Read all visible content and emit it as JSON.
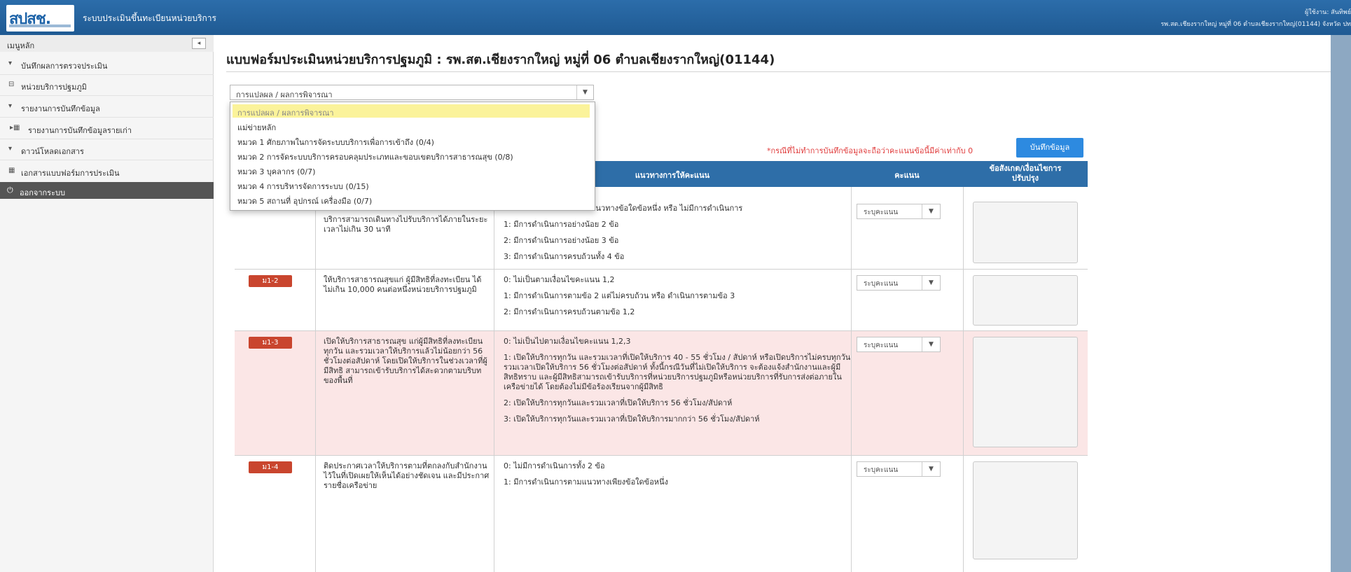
{
  "header": {
    "logo_text": "สปสช.",
    "app_title": "ระบบประเมินขึ้นทะเบียนหน่วยบริการ",
    "user_line1": "ผู้ใช้งาน: สันทิพย์",
    "user_line2": "รพ.สต.เชียงรากใหญ่ หมู่ที่ 06 ตำบลเชียงรากใหญ่(01144)   จังหวัด ปท"
  },
  "sidebar": {
    "main_menu": "เมนูหลัก",
    "collapse_icon": "◂",
    "sections": [
      {
        "label": "บันทึกผลการตรวจประเมิน"
      },
      {
        "label": "หน่วยบริการปฐมภูมิ"
      },
      {
        "label": "รายงานการบันทึกข้อมูล"
      },
      {
        "label": "รายงานการบันทึกข้อมูลรายเก่า"
      },
      {
        "label": "ดาวน์โหลดเอกสาร"
      },
      {
        "label": "เอกสารแบบฟอร์มการประเมิน"
      }
    ],
    "logout": "ออกจากระบบ"
  },
  "main": {
    "page_title": "แบบฟอร์มประเมินหน่วยบริการปฐมภูมิ : รพ.สต.เชียงรากใหญ่ หมู่ที่ 06 ตำบลเชียงรากใหญ่(01144)",
    "category_select": {
      "value": "การแปลผล / ผลการพิจารณา",
      "options": [
        "การแปลผล / ผลการพิจารณา",
        "แม่ข่ายหลัก",
        "หมวด 1 ศักยภาพในการจัดระบบบริการเพื่อการเข้าถึง (0/4)",
        "หมวด 2 การจัดระบบบริการครอบคลุมประเภทและขอบเขตบริการสาธารณสุข (0/8)",
        "หมวด 3 บุคลากร (0/7)",
        "หมวด 4 การบริหารจัดการระบบ (0/15)",
        "หมวด 5 สถานที่ อุปกรณ์ เครื่องมือ (0/7)"
      ]
    },
    "note": "*กรณีที่ไม่ทำการบันทึกข้อมูลจะถือว่าคะแนนข้อนี้มีค่าเท่ากับ 0",
    "save_label": "บันทึกข้อมูล",
    "table": {
      "headers": [
        "แนวทางการให้คะแนน",
        "คะแนน",
        "ข้อสังเกต/เงื่อนไขการ ปรับปรุง"
      ],
      "score_placeholder": "ระบุคะแนน",
      "rows": [
        {
          "code": "",
          "topic": "บริการสามารถเดินทางไปรับบริการได้ภายในระยะเวลาไม่เกิน 30 นาที",
          "criteria": [
            "0: ไม่มีการดำเนินการตามแนวทางข้อใดข้อหนึ่ง หรือ ไม่มีการดำเนินการ",
            "1: มีการดำเนินการอย่างน้อย 2 ข้อ",
            "2: มีการดำเนินการอย่างน้อย 3 ข้อ",
            "3: มีการดำเนินการครบถ้วนทั้ง 4 ข้อ"
          ]
        },
        {
          "code": "ม1-2",
          "topic": "ให้บริการสาธารณสุขแก่ ผู้มีสิทธิที่ลงทะเบียน ได้ ไม่เกิน 10,000 คนต่อหนึ่งหน่วยบริการปฐมภูมิ",
          "criteria": [
            "0: ไม่เป็นตามเงื่อนไขคะแนน 1,2",
            "1: มีการดำเนินการตามข้อ 2 แต่ไม่ครบถ้วน หรือ ดำเนินการตามข้อ 3",
            "2: มีการดำเนินการครบถ้วนตามข้อ 1,2"
          ]
        },
        {
          "code": "ม1-3",
          "topic": "เปิดให้บริการสาธารณสุข แก่ผู้มีสิทธิที่ลงทะเบียน ทุกวัน และรวมเวลาให้บริการแล้วไม่น้อยกว่า 56 ชั่วโมงต่อสัปดาห์ โดยเปิดให้บริการในช่วงเวลาที่ผู้มีสิทธิ สามารถเข้ารับบริการได้สะดวกตามบริบทของพื้นที่",
          "criteria": [
            "0: ไม่เป็นไปตามเงื่อนไขคะแนน 1,2,3",
            "1: เปิดให้บริการทุกวัน และรวมเวลาที่เปิดให้บริการ 40 - 55 ชั่วโมง / สัปดาห์ หรือเปิดบริการไม่ครบทุกวัน รวมเวลาเปิดให้บริการ 56 ชั่วโมงต่อสัปดาห์ ทั้งนี้กรณีวันที่ไม่เปิดให้บริการ จะต้องแจ้งสำนักงานและผู้มีสิทธิทราบ และผู้มีสิทธิสามารถเข้ารับบริการที่หน่วยบริการปฐมภูมิหรือหน่วยบริการที่รับการส่งต่อภายในเครือข่ายได้ โดยต้องไม่มีข้อร้องเรียนจากผู้มีสิทธิ",
            "2: เปิดให้บริการทุกวันและรวมเวลาที่เปิดให้บริการ 56 ชั่วโมง/สัปดาห์",
            "3: เปิดให้บริการทุกวันและรวมเวลาที่เปิดให้บริการมากกว่า 56 ชั่วโมง/สัปดาห์"
          ]
        },
        {
          "code": "ม1-4",
          "topic": "ติดประกาศเวลาให้บริการตามที่ตกลงกับสำนักงาน ไว้ในที่เปิดเผยให้เห็นได้อย่างชัดเจน และมีประกาศรายชื่อเครือข่าย",
          "criteria": [
            "0: ไม่มีการดำเนินการทั้ง 2 ข้อ",
            "1: มีการดำเนินการตามแนวทางเพียงข้อใดข้อหนึ่ง"
          ]
        }
      ]
    }
  }
}
